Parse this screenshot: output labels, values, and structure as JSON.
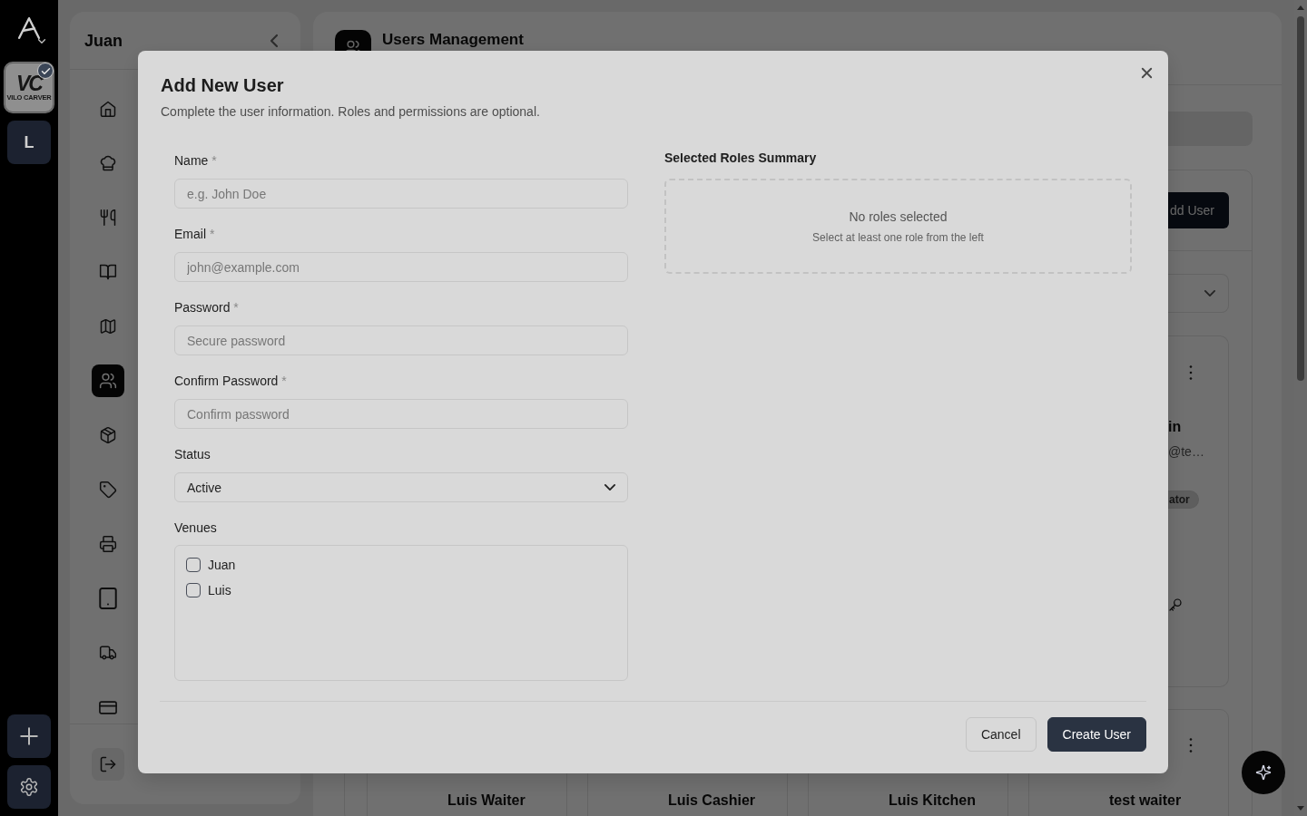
{
  "rail": {
    "venues": [
      {
        "kind": "logo",
        "monogram": "VC",
        "logo_text": "VILO CARVER",
        "selected": true
      },
      {
        "kind": "initial",
        "initial": "L",
        "selected": false
      }
    ]
  },
  "sidebar": {
    "title": "Juan",
    "nav": [
      {
        "selected": false
      },
      {
        "selected": false
      },
      {
        "selected": false
      },
      {
        "selected": false
      },
      {
        "selected": false
      },
      {
        "selected": true
      },
      {
        "selected": false
      },
      {
        "selected": false
      },
      {
        "selected": false
      },
      {
        "selected": false
      },
      {
        "selected": false
      },
      {
        "selected": false
      }
    ]
  },
  "main": {
    "title": "Users Management",
    "users_panel": {
      "add_button": "dd User",
      "card_rows": [
        [
          {
            "kind": "clipped",
            "name": "in",
            "email": "@te…",
            "roles": [
              "ator"
            ]
          }
        ],
        [
          {
            "kind": "lower",
            "name": "Luis Waiter"
          },
          {
            "kind": "lower",
            "name": "Luis Cashier"
          },
          {
            "kind": "lower",
            "name": "Luis Kitchen"
          },
          {
            "kind": "lower_with_menu",
            "name": "test waiter"
          }
        ]
      ]
    }
  },
  "modal": {
    "title": "Add New User",
    "description": "Complete the user information. Roles and permissions are optional.",
    "fields": [
      {
        "kind": "text",
        "label": "Name",
        "required_mark": "*",
        "placeholder": "e.g. John Doe"
      },
      {
        "kind": "email",
        "label": "Email",
        "required_mark": "*",
        "placeholder": "john@example.com"
      },
      {
        "kind": "password",
        "label": "Password",
        "required_mark": "*",
        "placeholder": "Secure password"
      },
      {
        "kind": "password",
        "label": "Confirm Password",
        "required_mark": "*",
        "placeholder": "Confirm password"
      },
      {
        "kind": "select",
        "label": "Status",
        "value": "Active"
      },
      {
        "kind": "checklist",
        "label": "Venues",
        "options": [
          {
            "label": "Juan",
            "checked": false
          },
          {
            "label": "Luis",
            "checked": false
          }
        ]
      }
    ],
    "roles_summary": {
      "title": "Selected Roles Summary",
      "empty_title": "No roles selected",
      "empty_hint": "Select at least one role from the left"
    },
    "buttons": [
      {
        "kind": "secondary",
        "label": "Cancel"
      },
      {
        "kind": "primary",
        "label": "Create User"
      }
    ]
  }
}
